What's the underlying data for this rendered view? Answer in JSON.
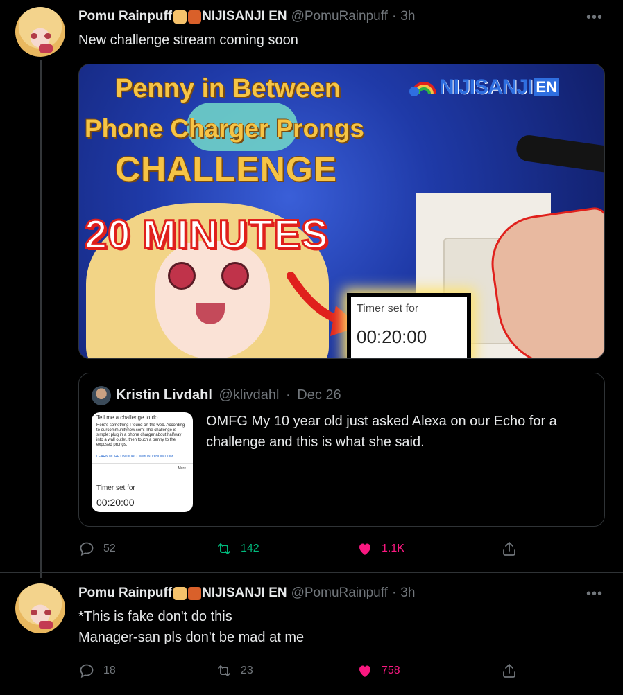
{
  "tweet1": {
    "display_name": "Pomu Rainpuff",
    "name_suffix": "NIJISANJI EN",
    "handle": "@PomuRainpuff",
    "time": "3h",
    "more": "•••",
    "text": "New challenge stream coming soon",
    "media": {
      "title_line1": "Penny in Between",
      "title_line2": "Phone Charger Prongs",
      "title_line3": "CHALLENGE",
      "minutes": "20 MINUTES",
      "timer_label": "Timer set for",
      "timer_value": "00:20:00",
      "logo_text": "NIJISANJI",
      "logo_en": "EN"
    },
    "quote": {
      "display_name": "Kristin Livdahl",
      "handle": "@klivdahl",
      "date": "Dec 26",
      "text": "OMFG My 10 year old just asked Alexa on our Echo for a challenge and this is what she said.",
      "thumb": {
        "heading": "Tell me a challenge to do",
        "body": "Here's something I found on the web. According to ourcommunitynow.com: The challenge is simple: plug in a phone charger about halfway into a wall outlet, then touch a penny to the exposed prongs.",
        "link": "LEARN MORE ON OURCOMMUNITYNOW.COM",
        "more": "More",
        "timer_label": "Timer set for",
        "timer_value": "00:20:00"
      }
    },
    "actions": {
      "replies": "52",
      "retweets": "142",
      "likes": "1.1K"
    }
  },
  "tweet2": {
    "display_name": "Pomu Rainpuff",
    "name_suffix": "NIJISANJI EN",
    "handle": "@PomuRainpuff",
    "time": "3h",
    "more": "•••",
    "text_line1": "*This is fake don't do this",
    "text_line2": "Manager-san pls don't be mad at me",
    "actions": {
      "replies": "18",
      "retweets": "23",
      "likes": "758"
    }
  },
  "colors": {
    "background": "#000000",
    "text": "#e7e9ea",
    "muted": "#71767b",
    "retweet_active": "#00ba7c",
    "like_active": "#f91880",
    "border": "#2f3336"
  },
  "icons": [
    "reply-icon",
    "retweet-icon",
    "like-icon",
    "share-icon",
    "more-icon"
  ]
}
